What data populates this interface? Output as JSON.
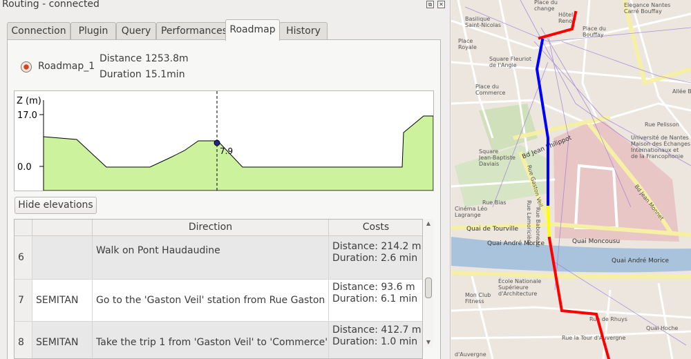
{
  "window": {
    "title": "Routing - connected",
    "restore_glyph": "⧉",
    "close_glyph": "✕"
  },
  "tabs": [
    {
      "label": "Connection"
    },
    {
      "label": "Plugin"
    },
    {
      "label": "Query"
    },
    {
      "label": "Performances"
    },
    {
      "label": "Roadmap",
      "active": true
    },
    {
      "label": "History"
    }
  ],
  "roadmap": {
    "name": "Roadmap_1",
    "distance_label": "Distance",
    "distance_value": "1253.8m",
    "duration_label": "Duration",
    "duration_value": "15.1min"
  },
  "elevation_chart": {
    "axis_label": "Z (m)",
    "ytick_top": "17.0",
    "ytick_bottom": "0.0",
    "cursor_label": "7.9",
    "fill_color": "#ccf29e"
  },
  "hide_button": "Hide elevations",
  "table": {
    "headers": {
      "num": "",
      "network": "",
      "direction": "Direction",
      "costs": "Costs"
    },
    "rows": [
      {
        "num": "6",
        "network": "",
        "direction": "Walk on Pont Haudaudine",
        "cost1": "Distance: 214.2 m",
        "cost2": "Duration: 2.6 min"
      },
      {
        "num": "7",
        "network": "SEMITAN",
        "direction": "Go to the 'Gaston Veil' station from Rue Gaston Ve",
        "cost1": "Distance: 93.6 m",
        "cost2": "Duration: 6.1 min"
      },
      {
        "num": "8",
        "network": "SEMITAN",
        "direction": "Take the trip 1 from 'Gaston Veil' to 'Commerce'",
        "cost1": "Distance: 412.7 m",
        "cost2": "Duration: 1.0 min"
      }
    ]
  },
  "map": {
    "labels": {
      "place_change": "Place du\nchange",
      "hotel": "Hôtel\nRenoir",
      "basilique": "Basilique\nSaint-Nicolas",
      "elegance": "Elegance Nantes\nCarré Bouffay",
      "place_bouffay": "Place du\nBouffay",
      "place_royale": "Place\nRoyale",
      "square_fleuriot": "Square Fleuriot\nde l'Angle",
      "place_commerce": "Place du\nCommerce",
      "allee_br": "Allée Br",
      "rue_pelisson": "Rue Pelisson",
      "universite": "Université de Nantes\nMaison des Échanges\nInternationaux et\nde la Francophonie",
      "square_jbd": "Square\nJean-Baptiste\nDaviais",
      "bd_philippot": "Bd Jean Philippot",
      "bd_jean_monnet": "Bd Jean Monnet",
      "rue_gaston_veil": "Rue Gaston Veil",
      "rue_bias": "Rue Bias",
      "rue_lamoriciere": "Rue Lamoricière",
      "rue_baboneau": "Rue Baboneau",
      "cinema": "Cinéma Léo\nLagrange",
      "quai_tourville": "Quai de Tourville",
      "quai_moncousu": "Quai Moncousu",
      "quai_andre_morice_left": "Quai André Morice",
      "quai_andre_morice_right": "Quai André Morice",
      "ecole": "École Nationale\nSupérieure\nd'Architecture",
      "mon_club": "Mon Club\nFitness",
      "rue_rhuys": "Rue de Rhuys",
      "quai_hoche": "Quai Hoche",
      "rue_la_tour": "Rue la Tour d'Auvergne",
      "rue_auvergne": "d'Auvergne"
    },
    "route_colors": {
      "walk": "#ff0000",
      "bus": "#0000ff",
      "tram": "#ffff00"
    }
  }
}
